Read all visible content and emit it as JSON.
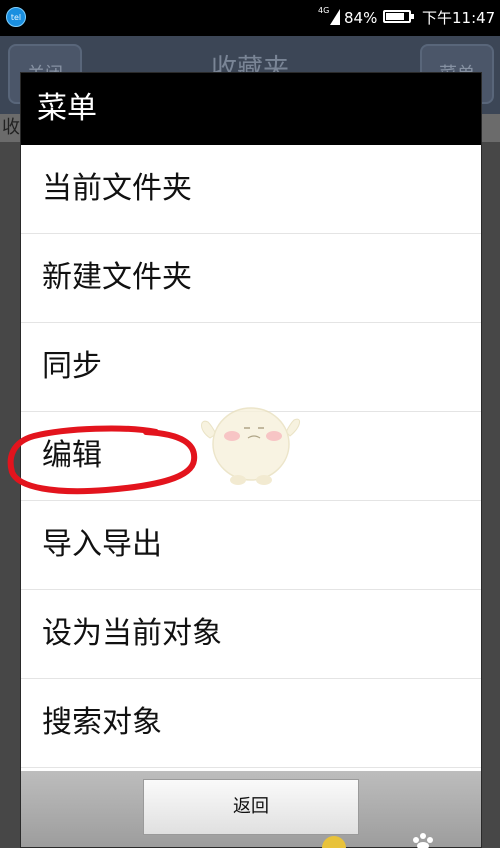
{
  "status_bar": {
    "app_icon_label": "tel",
    "network": "4G",
    "battery": "84%",
    "battery_level": 0.84,
    "time": "下午11:47"
  },
  "background_app": {
    "close_label": "关闭",
    "title": "收藏夹",
    "menu_label": "菜单",
    "strip_text": "收"
  },
  "dialog": {
    "title": "菜单",
    "items": [
      {
        "label": "当前文件夹"
      },
      {
        "label": "新建文件夹"
      },
      {
        "label": "同步"
      },
      {
        "label": "编辑"
      },
      {
        "label": "导入导出"
      },
      {
        "label": "设为当前对象"
      },
      {
        "label": "搜索对象"
      }
    ],
    "back_label": "返回"
  },
  "colors": {
    "header_bg": "#000000",
    "highlight": "#e3141d",
    "footer_bg": "#a9a9a9"
  }
}
